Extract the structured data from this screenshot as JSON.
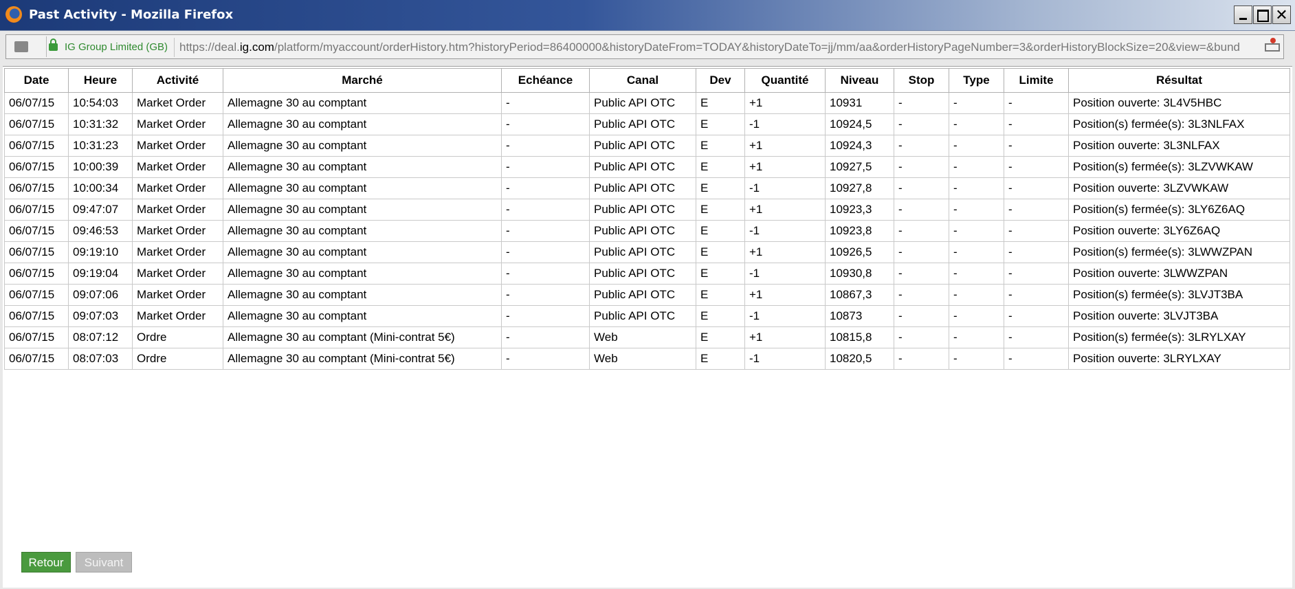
{
  "window": {
    "title": "Past Activity - Mozilla Firefox"
  },
  "urlbar": {
    "identity": "IG Group Limited (GB)",
    "url_prefix": "https://deal.",
    "url_host": "ig.com",
    "url_rest": "/platform/myaccount/orderHistory.htm?historyPeriod=86400000&historyDateFrom=TODAY&historyDateTo=jj/mm/aa&orderHistoryPageNumber=3&orderHistoryBlockSize=20&view=&bund"
  },
  "table": {
    "headers": [
      "Date",
      "Heure",
      "Activité",
      "Marché",
      "Echéance",
      "Canal",
      "Dev",
      "Quantité",
      "Niveau",
      "Stop",
      "Type",
      "Limite",
      "Résultat"
    ],
    "rows": [
      [
        "06/07/15",
        "10:54:03",
        "Market Order",
        "Allemagne 30 au comptant",
        "-",
        "Public API OTC",
        "E",
        "+1",
        "10931",
        "-",
        "-",
        "-",
        "Position ouverte: 3L4V5HBC"
      ],
      [
        "06/07/15",
        "10:31:32",
        "Market Order",
        "Allemagne 30 au comptant",
        "-",
        "Public API OTC",
        "E",
        "-1",
        "10924,5",
        "-",
        "-",
        "-",
        "Position(s) fermée(s): 3L3NLFAX"
      ],
      [
        "06/07/15",
        "10:31:23",
        "Market Order",
        "Allemagne 30 au comptant",
        "-",
        "Public API OTC",
        "E",
        "+1",
        "10924,3",
        "-",
        "-",
        "-",
        "Position ouverte: 3L3NLFAX"
      ],
      [
        "06/07/15",
        "10:00:39",
        "Market Order",
        "Allemagne 30 au comptant",
        "-",
        "Public API OTC",
        "E",
        "+1",
        "10927,5",
        "-",
        "-",
        "-",
        "Position(s) fermée(s): 3LZVWKAW"
      ],
      [
        "06/07/15",
        "10:00:34",
        "Market Order",
        "Allemagne 30 au comptant",
        "-",
        "Public API OTC",
        "E",
        "-1",
        "10927,8",
        "-",
        "-",
        "-",
        "Position ouverte: 3LZVWKAW"
      ],
      [
        "06/07/15",
        "09:47:07",
        "Market Order",
        "Allemagne 30 au comptant",
        "-",
        "Public API OTC",
        "E",
        "+1",
        "10923,3",
        "-",
        "-",
        "-",
        "Position(s) fermée(s): 3LY6Z6AQ"
      ],
      [
        "06/07/15",
        "09:46:53",
        "Market Order",
        "Allemagne 30 au comptant",
        "-",
        "Public API OTC",
        "E",
        "-1",
        "10923,8",
        "-",
        "-",
        "-",
        "Position ouverte: 3LY6Z6AQ"
      ],
      [
        "06/07/15",
        "09:19:10",
        "Market Order",
        "Allemagne 30 au comptant",
        "-",
        "Public API OTC",
        "E",
        "+1",
        "10926,5",
        "-",
        "-",
        "-",
        "Position(s) fermée(s): 3LWWZPAN"
      ],
      [
        "06/07/15",
        "09:19:04",
        "Market Order",
        "Allemagne 30 au comptant",
        "-",
        "Public API OTC",
        "E",
        "-1",
        "10930,8",
        "-",
        "-",
        "-",
        "Position ouverte: 3LWWZPAN"
      ],
      [
        "06/07/15",
        "09:07:06",
        "Market Order",
        "Allemagne 30 au comptant",
        "-",
        "Public API OTC",
        "E",
        "+1",
        "10867,3",
        "-",
        "-",
        "-",
        "Position(s) fermée(s): 3LVJT3BA"
      ],
      [
        "06/07/15",
        "09:07:03",
        "Market Order",
        "Allemagne 30 au comptant",
        "-",
        "Public API OTC",
        "E",
        "-1",
        "10873",
        "-",
        "-",
        "-",
        "Position ouverte: 3LVJT3BA"
      ],
      [
        "06/07/15",
        "08:07:12",
        "Ordre",
        "Allemagne 30 au comptant (Mini-contrat 5€)",
        "-",
        "Web",
        "E",
        "+1",
        "10815,8",
        "-",
        "-",
        "-",
        "Position(s) fermée(s): 3LRYLXAY"
      ],
      [
        "06/07/15",
        "08:07:03",
        "Ordre",
        "Allemagne 30 au comptant (Mini-contrat 5€)",
        "-",
        "Web",
        "E",
        "-1",
        "10820,5",
        "-",
        "-",
        "-",
        "Position ouverte: 3LRYLXAY"
      ]
    ]
  },
  "pagination": {
    "back_label": "Retour",
    "next_label": "Suivant"
  }
}
